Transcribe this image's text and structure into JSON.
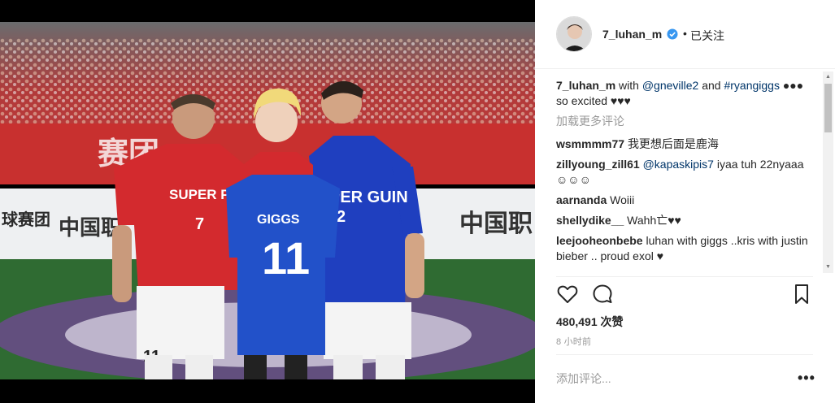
{
  "post": {
    "username": "7_luhan_m",
    "follow_status": "已关注",
    "dot": "•"
  },
  "photo": {
    "shirt_left_text": "SUPER PENGUIN",
    "shirt_left_number": "7",
    "held_shirt_name": "GIGGS",
    "held_shirt_number": "11",
    "shirt_right_text": "PER GUIN",
    "shirt_right_number": "2",
    "shorts_number": "11",
    "banner_text_1": "中国职",
    "banner_text_2": "中国职",
    "banner_text_3": "球赛团",
    "banner_text_4": "赛团"
  },
  "caption": {
    "username": "7_luhan_m",
    "text_1": "with",
    "mention_1": "@gneville2",
    "text_2": "and",
    "hashtag": "#ryangiggs",
    "text_3": "●●● so excited ♥♥♥"
  },
  "load_more": "加载更多评论",
  "comments": [
    {
      "user": "wsmmmm77",
      "text": "我更想后面是鹿海"
    },
    {
      "user": "zillyoung_zill61",
      "mention": "@kapaskipis7",
      "text": "iyaa tuh 22nyaaa ☺☺☺"
    },
    {
      "user": "aarnanda",
      "text": "Woiii"
    },
    {
      "user": "shellydike__",
      "text": "Wahh亡♥♥"
    },
    {
      "user": "leejooheonbebe",
      "text": "luhan with giggs ..kris with justin bieber .. proud exol ♥"
    }
  ],
  "likes": "480,491 次赞",
  "timestamp": "8 小时前",
  "add_comment_placeholder": "添加评论...",
  "more_options": "•••",
  "colors": {
    "accent": "#3897f0",
    "link": "#003569",
    "red_jersey": "#d32a2e",
    "blue_jersey": "#1f3fbf"
  }
}
